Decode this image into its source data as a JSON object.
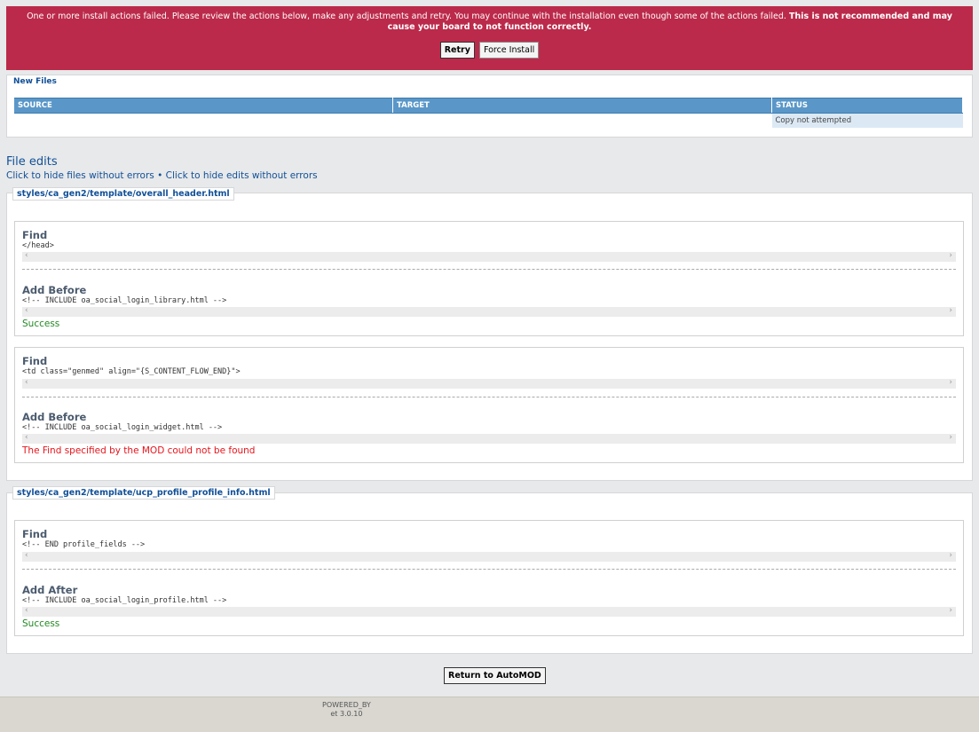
{
  "error": {
    "message": "One or more install actions failed. Please review the actions below, make any adjustments and retry. You may continue with the installation even though some of the actions failed.",
    "warning": "This is not recommended and may cause your board to not function correctly.",
    "retry_label": "Retry",
    "force_label": "Force Install"
  },
  "new_files": {
    "title": "New Files",
    "columns": [
      "SOURCE",
      "TARGET",
      "STATUS"
    ],
    "rows": [
      {
        "source": "",
        "target": "",
        "status": "Copy not attempted"
      }
    ]
  },
  "file_edits": {
    "title": "File edits",
    "hide_files": "Click to hide files without errors",
    "bullet": "•",
    "hide_edits": "Click to hide edits without errors",
    "files": [
      {
        "path": "styles/ca_gen2/template/overall_header.html",
        "edits": [
          {
            "find_label": "Find",
            "find_code": "</head>",
            "action_label": "Add Before",
            "action_code": "<!-- INCLUDE oa_social_login_library.html -->",
            "result": "Success"
          },
          {
            "find_label": "Find",
            "find_code": "<td class=\"genmed\" align=\"{S_CONTENT_FLOW_END}\">",
            "action_label": "Add Before",
            "action_code": "<!-- INCLUDE oa_social_login_widget.html -->",
            "result": "The Find specified by the MOD could not be found"
          }
        ]
      },
      {
        "path": "styles/ca_gen2/template/ucp_profile_profile_info.html",
        "edits": [
          {
            "find_label": "Find",
            "find_code": "<!-- END profile_fields -->",
            "action_label": "Add After",
            "action_code": "<!-- INCLUDE oa_social_login_profile.html -->",
            "result": "Success"
          }
        ]
      }
    ]
  },
  "return_label": "Return to AutoMOD",
  "footer": {
    "line1": "POWERED_BY",
    "line2": "et 3.0.10"
  },
  "icons": {
    "scroll_left": "‹",
    "scroll_right": "›"
  },
  "colors": {
    "error_bg": "#bb2a4a",
    "header_blue": "#5a97c8",
    "link_blue": "#115098",
    "success": "#228822",
    "fail": "#e8131b"
  }
}
